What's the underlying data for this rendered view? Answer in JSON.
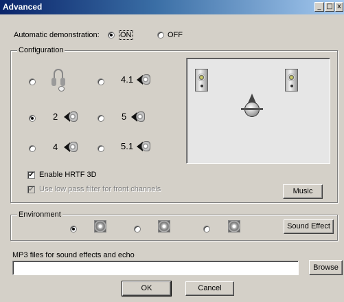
{
  "window": {
    "title": "Advanced",
    "min": "_",
    "max": "□",
    "close": "x"
  },
  "auto_demo": {
    "label": "Automatic demonstration:",
    "on": "ON",
    "off": "OFF"
  },
  "configuration": {
    "title": "Configuration",
    "options": [
      {
        "id": "headphones",
        "label": ""
      },
      {
        "id": "4.1",
        "label": "4.1"
      },
      {
        "id": "2",
        "label": "2"
      },
      {
        "id": "5",
        "label": "5"
      },
      {
        "id": "4",
        "label": "4"
      },
      {
        "id": "5.1",
        "label": "5.1"
      }
    ],
    "selected": "2",
    "hrtf_label": "Enable HRTF 3D",
    "lowpass_label": "Use low pass filter for front channels",
    "music_button": "Music"
  },
  "environment": {
    "title": "Environment",
    "options": [
      "env-1",
      "env-2",
      "env-3"
    ],
    "selected": "env-1",
    "sound_effect_button": "Sound Effect"
  },
  "mp3": {
    "label": "MP3 files for sound effects and echo",
    "value": "",
    "browse": "Browse"
  },
  "footer": {
    "ok": "OK",
    "cancel": "Cancel"
  }
}
